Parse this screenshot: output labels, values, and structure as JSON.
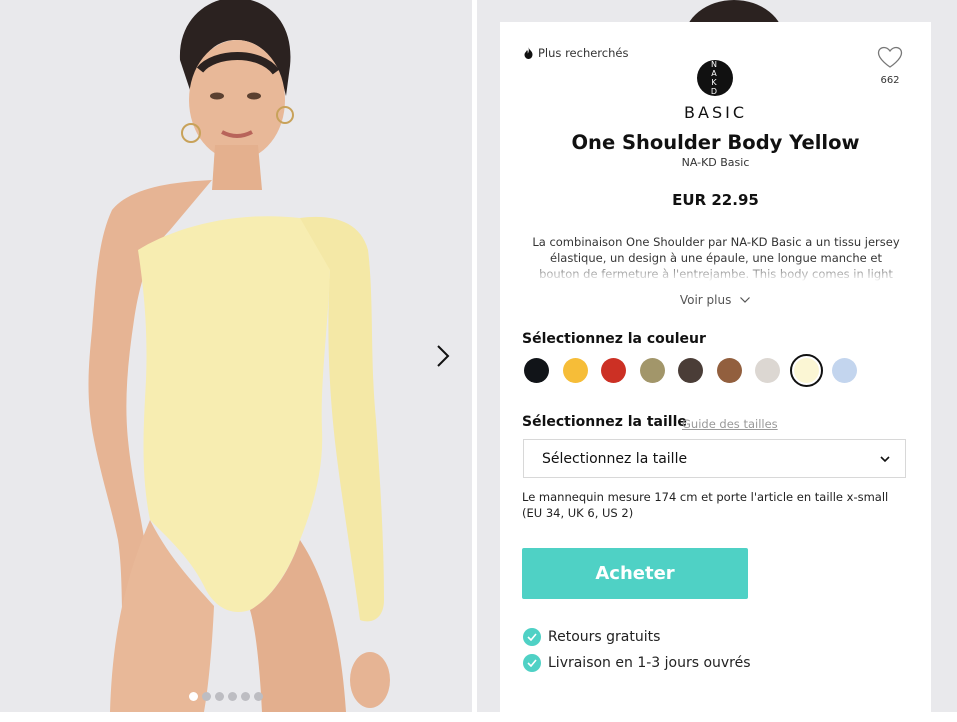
{
  "gallery": {
    "slide_count": 6,
    "active_index": 0
  },
  "product": {
    "hot_label": "Plus recherchés",
    "wishlist_count": "662",
    "brand_logo": [
      "N A",
      "K D"
    ],
    "brand_line": "BASIC",
    "title": "One Shoulder Body Yellow",
    "brand": "NA-KD Basic",
    "price": "EUR 22.95",
    "description": "La combinaison One Shoulder par NA-KD Basic a un tissu jersey élastique, un design à une épaule, une longue manche et bouton de fermeture à l'entrejambe. This body comes in light",
    "see_more": "Voir plus"
  },
  "color": {
    "label": "Sélectionnez la couleur",
    "swatches": [
      "#111418",
      "#f6bd38",
      "#cc3024",
      "#a2966a",
      "#4a3d37",
      "#925f3e",
      "#dcd7d2",
      "#fbf6d4",
      "#c3d5ee"
    ],
    "selected_index": 7
  },
  "size": {
    "label": "Sélectionnez la taille",
    "guide": "Guide des tailles",
    "select_value": "Sélectionnez la taille"
  },
  "model_info": "Le mannequin mesure 174 cm et porte l'article en taille x-small (EU 34, UK 6, US 2)",
  "buy_label": "Acheter",
  "perks": [
    "Retours gratuits",
    "Livraison en 1-3 jours ouvrés"
  ],
  "colors": {
    "accent": "#4fd1c5",
    "background": "#e9e9ec",
    "garment": "#f7edb1"
  }
}
